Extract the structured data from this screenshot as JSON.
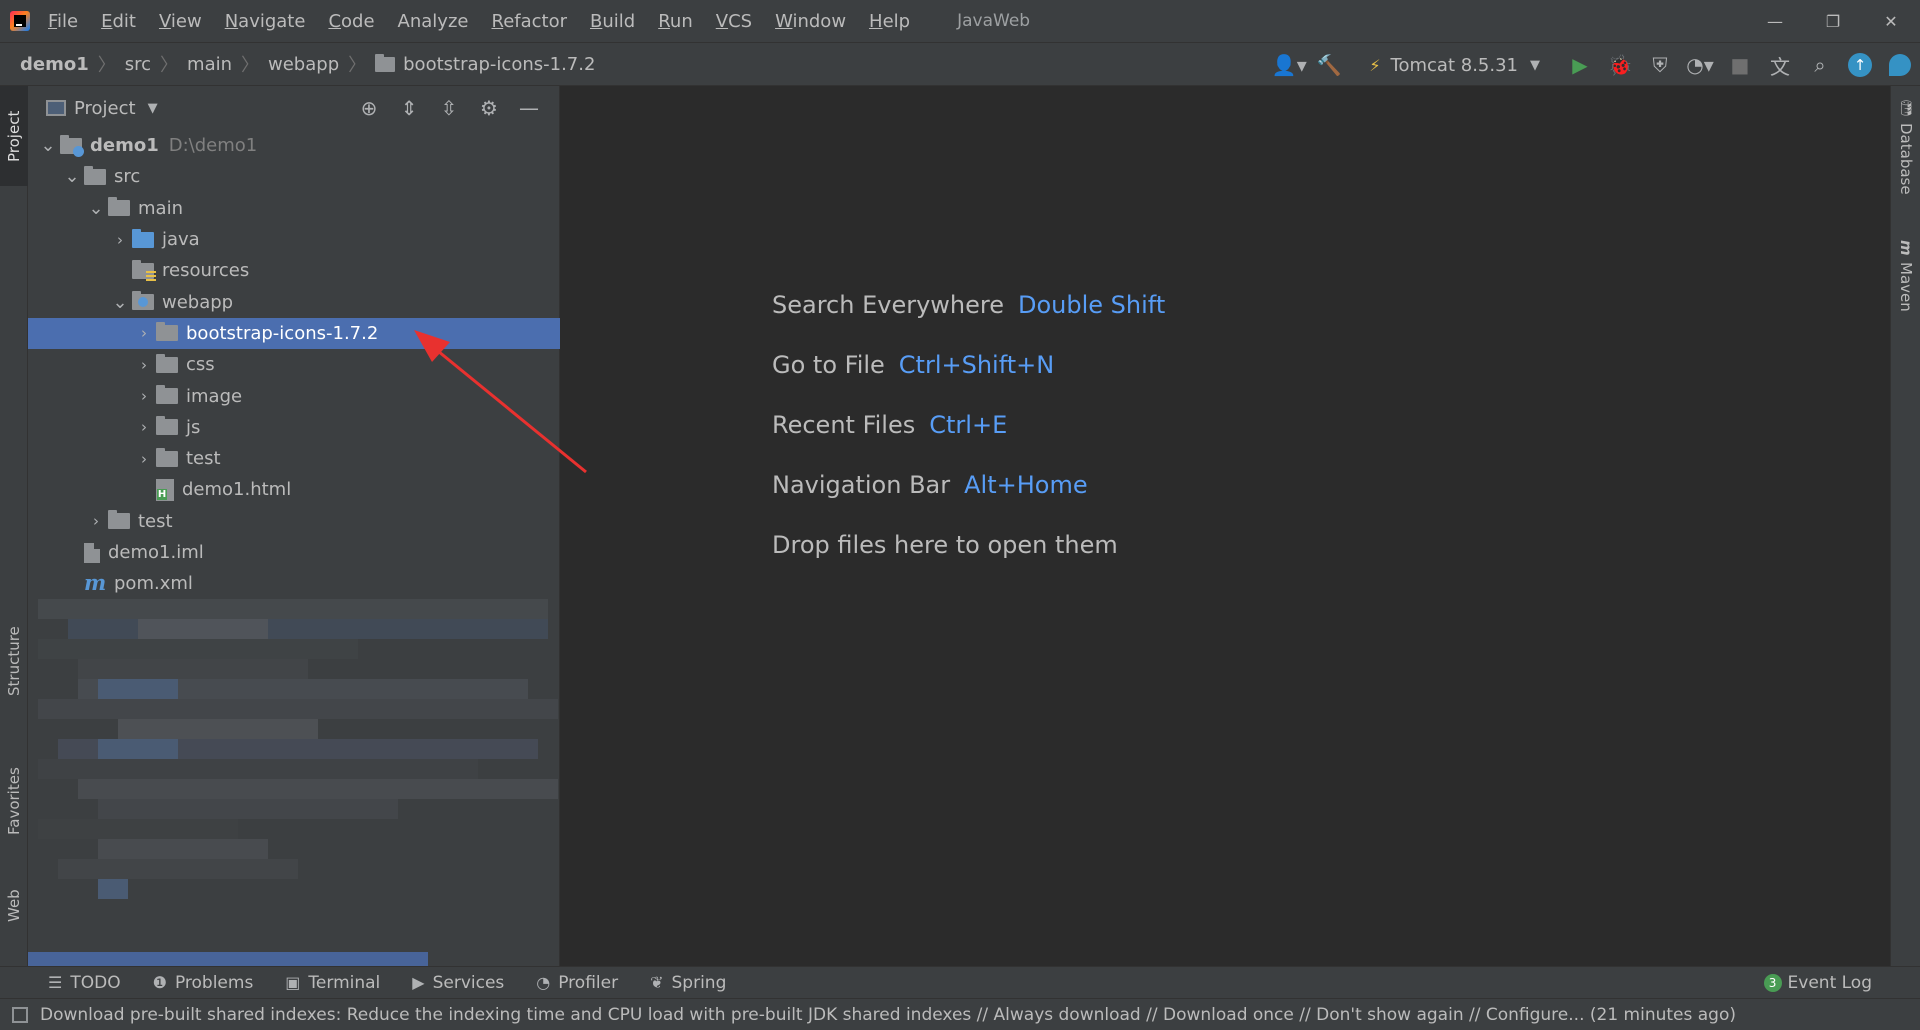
{
  "menubar": {
    "items": [
      {
        "mn": "F",
        "rest": "ile"
      },
      {
        "mn": "E",
        "rest": "dit"
      },
      {
        "mn": "V",
        "rest": "iew"
      },
      {
        "mn": "N",
        "rest": "avigate"
      },
      {
        "mn": "C",
        "rest": "ode"
      },
      {
        "mn": "",
        "rest": "Analyze"
      },
      {
        "mn": "R",
        "rest": "efactor"
      },
      {
        "mn": "B",
        "rest": "uild"
      },
      {
        "mn": "R",
        "rest": "un"
      },
      {
        "mn": "V",
        "rest": "CS"
      },
      {
        "mn": "W",
        "rest": "indow"
      },
      {
        "mn": "H",
        "rest": "elp"
      }
    ],
    "window_title": "JavaWeb"
  },
  "breadcrumb": [
    "demo1",
    "src",
    "main",
    "webapp",
    "bootstrap-icons-1.7.2"
  ],
  "run_config": {
    "label": "Tomcat 8.5.31"
  },
  "project_panel": {
    "title": "Project",
    "tree": [
      {
        "depth": 0,
        "expanded": true,
        "icon": "module",
        "label": "demo1",
        "hint": "D:\\demo1",
        "bold": true
      },
      {
        "depth": 1,
        "expanded": true,
        "icon": "folder",
        "label": "src"
      },
      {
        "depth": 2,
        "expanded": true,
        "icon": "folder",
        "label": "main"
      },
      {
        "depth": 3,
        "expanded": false,
        "icon": "blue",
        "label": "java"
      },
      {
        "depth": 3,
        "expanded": null,
        "icon": "res",
        "label": "resources"
      },
      {
        "depth": 3,
        "expanded": true,
        "icon": "web",
        "label": "webapp"
      },
      {
        "depth": 4,
        "expanded": false,
        "icon": "folder",
        "label": "bootstrap-icons-1.7.2",
        "selected": true
      },
      {
        "depth": 4,
        "expanded": false,
        "icon": "folder",
        "label": "css"
      },
      {
        "depth": 4,
        "expanded": false,
        "icon": "folder",
        "label": "image"
      },
      {
        "depth": 4,
        "expanded": false,
        "icon": "folder",
        "label": "js"
      },
      {
        "depth": 4,
        "expanded": false,
        "icon": "folder",
        "label": "test"
      },
      {
        "depth": 4,
        "expanded": null,
        "icon": "html",
        "label": "demo1.html"
      },
      {
        "depth": 2,
        "expanded": false,
        "icon": "folder",
        "label": "test"
      },
      {
        "depth": 1,
        "expanded": null,
        "icon": "iml",
        "label": "demo1.iml"
      },
      {
        "depth": 1,
        "expanded": null,
        "icon": "maven",
        "label": "pom.xml"
      }
    ]
  },
  "left_stripe": {
    "project": "Project",
    "structure": "Structure",
    "favorites": "Favorites",
    "web": "Web"
  },
  "right_stripe": {
    "database": "Database",
    "maven": "Maven"
  },
  "editor": {
    "hints": [
      {
        "label": "Search Everywhere",
        "shortcut": "Double Shift"
      },
      {
        "label": "Go to File",
        "shortcut": "Ctrl+Shift+N"
      },
      {
        "label": "Recent Files",
        "shortcut": "Ctrl+E"
      },
      {
        "label": "Navigation Bar",
        "shortcut": "Alt+Home"
      },
      {
        "label": "Drop files here to open them",
        "shortcut": ""
      }
    ]
  },
  "bottom_tabs": [
    {
      "icon": "list-icon",
      "glyph": "☰",
      "label": "TODO"
    },
    {
      "icon": "problems-icon",
      "glyph": "❶",
      "label": "Problems"
    },
    {
      "icon": "terminal-icon",
      "glyph": "▣",
      "label": "Terminal"
    },
    {
      "icon": "services-icon",
      "glyph": "▶",
      "label": "Services"
    },
    {
      "icon": "profiler-icon",
      "glyph": "◔",
      "label": "Profiler"
    },
    {
      "icon": "spring-icon",
      "glyph": "❦",
      "label": "Spring"
    }
  ],
  "event_log": {
    "count": "3",
    "label": "Event Log"
  },
  "status": {
    "message": "Download pre-built shared indexes: Reduce the indexing time and CPU load with pre-built JDK shared indexes // Always download // Download once // Don't show again // Configure... (21 minutes ago)"
  },
  "colors": {
    "background": "#2b2b2b",
    "panel": "#3c3f41",
    "selection": "#4b6eaf",
    "shortcut": "#589df6",
    "annotation_arrow": "#e8312f"
  }
}
